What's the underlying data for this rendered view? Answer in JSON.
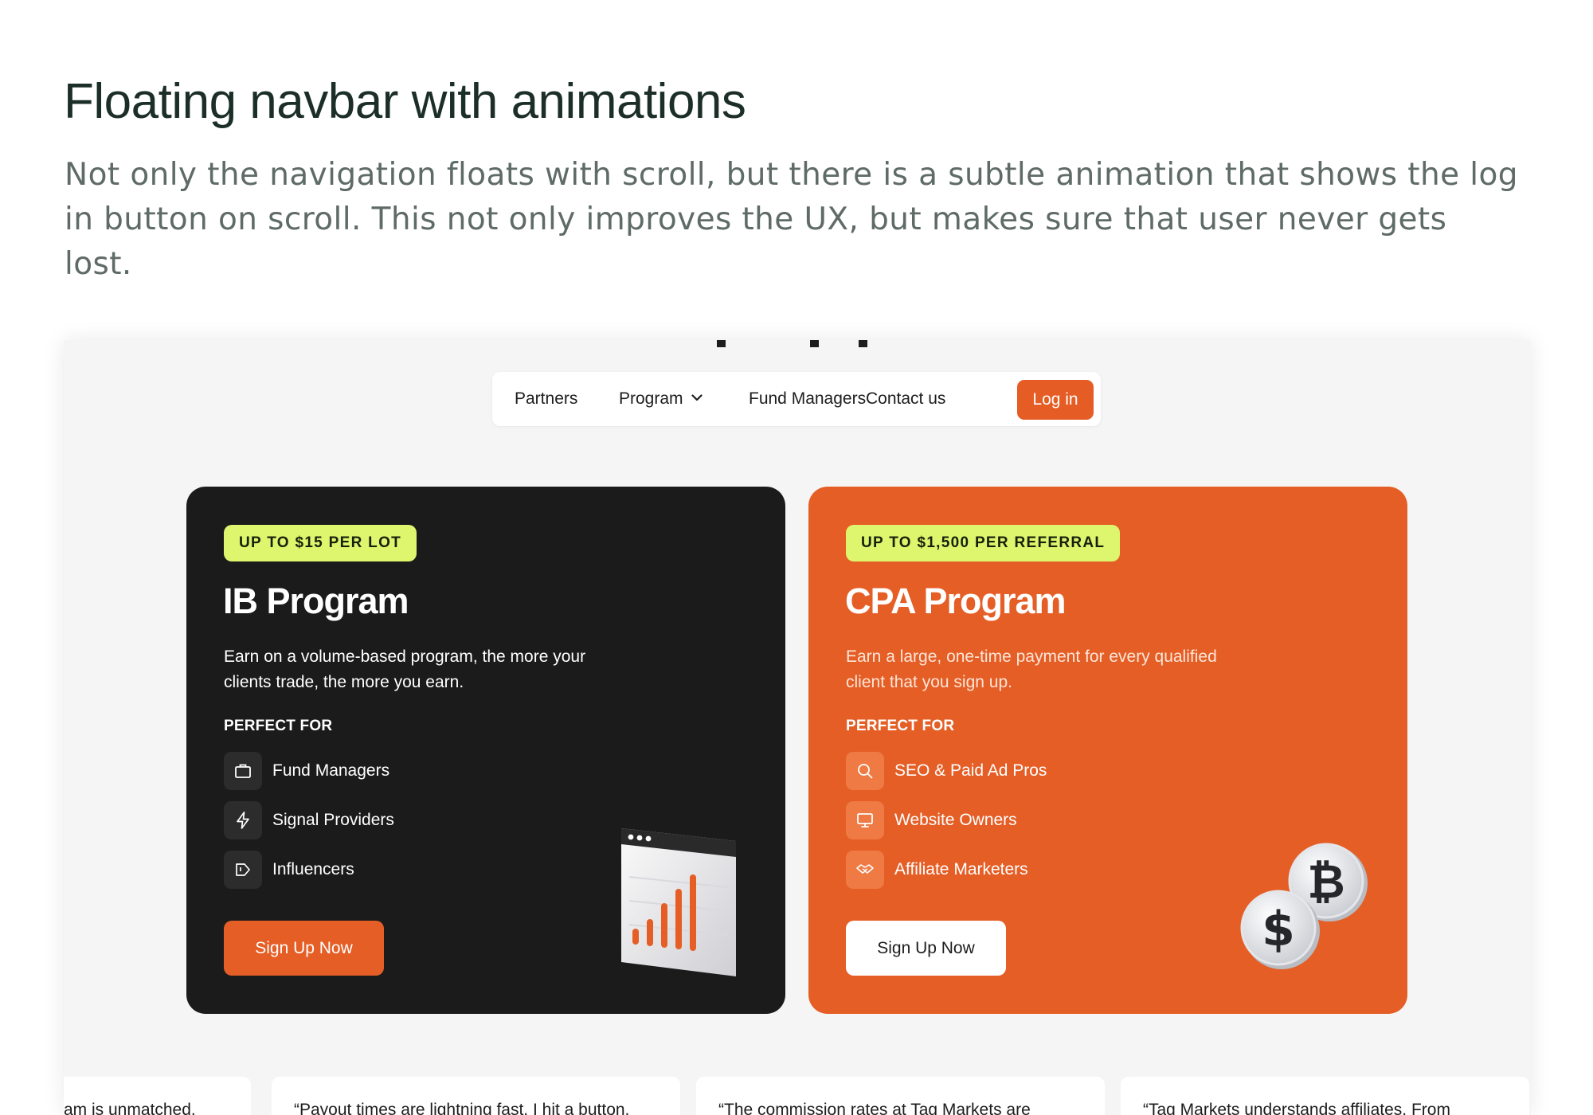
{
  "article": {
    "title": "Floating navbar with animations",
    "body": "Not only the navigation floats with scroll, but there is a subtle animation that shows the log in button on scroll. This not only improves the UX, but makes sure that user never gets lost."
  },
  "navbar": {
    "items": [
      "Partners",
      "Program",
      "Fund Managers",
      "Contact us"
    ],
    "login_label": "Log in"
  },
  "cards": [
    {
      "badge": "UP TO $15 PER LOT",
      "title": "IB Program",
      "description": "Earn on a volume-based program, the more your clients trade, the more you earn.",
      "perfect_for_label": "PERFECT FOR",
      "features": [
        {
          "label": "Fund Managers",
          "icon": "briefcase-icon"
        },
        {
          "label": "Signal Providers",
          "icon": "lightning-icon"
        },
        {
          "label": "Influencers",
          "icon": "megaphone-icon"
        }
      ],
      "cta": "Sign Up Now"
    },
    {
      "badge": "UP TO $1,500 PER REFERRAL",
      "title": "CPA Program",
      "description": "Earn a large, one-time payment for every qualified client that you sign up.",
      "perfect_for_label": "PERFECT FOR",
      "features": [
        {
          "label": "SEO & Paid Ad Pros",
          "icon": "search-icon"
        },
        {
          "label": "Website Owners",
          "icon": "monitor-icon"
        },
        {
          "label": "Affiliate Marketers",
          "icon": "handshake-icon"
        }
      ],
      "cta": "Sign Up Now"
    }
  ],
  "testimonials": [
    "am is unmatched.",
    "“Payout times are lightning fast. I hit a button,",
    "“The commission rates at Tag Markets are",
    "“Tag Markets understands affiliates. From"
  ],
  "colors": {
    "accent_orange": "#e55e26",
    "badge_lime": "#ddf66d",
    "dark_card": "#1b1b1b",
    "heading": "#1c2e28"
  }
}
